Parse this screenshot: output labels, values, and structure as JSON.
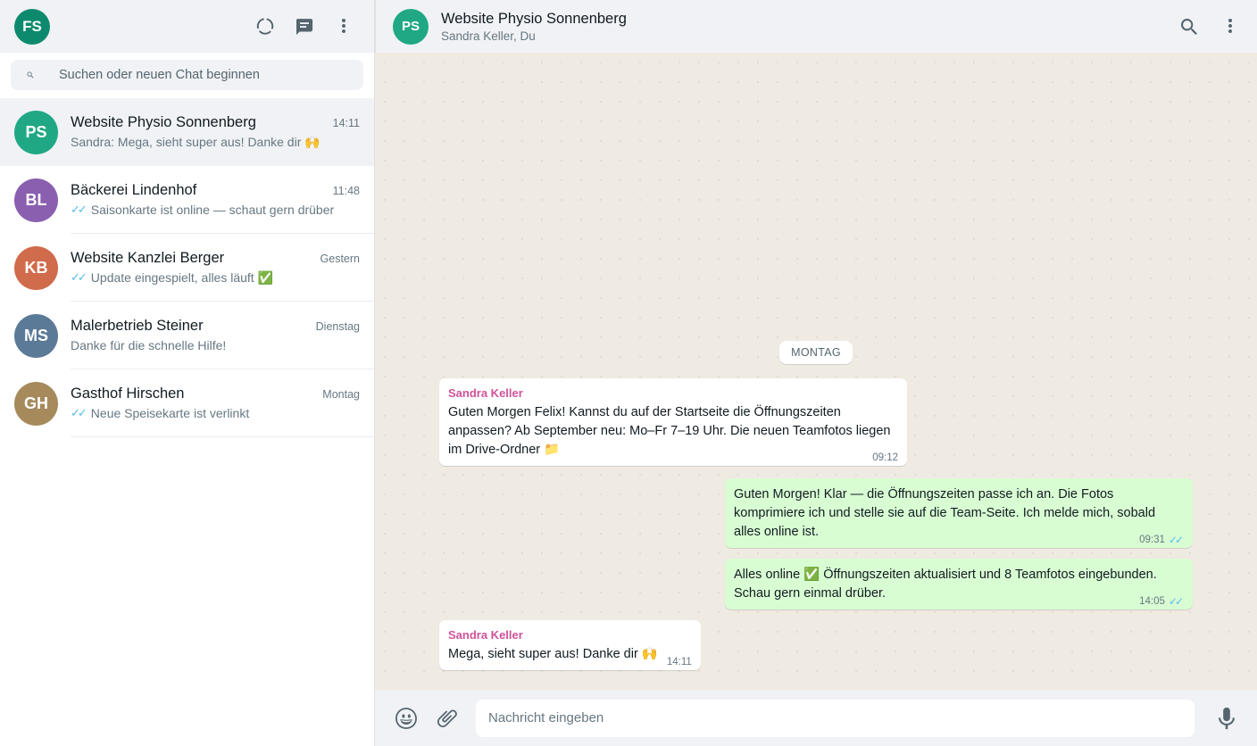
{
  "colors": {
    "me_avatar": "#0d8a6e",
    "accent": "#25d366",
    "sender_name": "#d0529a",
    "read_ticks": "#53bdeb"
  },
  "me": {
    "initials": "FS"
  },
  "left_header": {
    "icons": [
      "status-icon",
      "new-chat-icon",
      "menu-icon"
    ]
  },
  "search": {
    "placeholder": "Suchen oder neuen Chat beginnen",
    "value": ""
  },
  "chats": [
    {
      "initials": "PS",
      "avatar_color": "#20a884",
      "name": "Website Physio Sonnenberg",
      "time": "14:11",
      "ticks": "",
      "preview": "Sandra: Mega, sieht super aus! Danke dir 🙌",
      "active": true
    },
    {
      "initials": "BL",
      "avatar_color": "#8a5fb0",
      "name": "Bäckerei Lindenhof",
      "time": "11:48",
      "ticks": "✓✓",
      "preview": "Saisonkarte ist online — schaut gern drüber",
      "active": false
    },
    {
      "initials": "KB",
      "avatar_color": "#d06b4b",
      "name": "Website Kanzlei Berger",
      "time": "Gestern",
      "ticks": "✓✓",
      "preview": "Update eingespielt, alles läuft ✅",
      "active": false
    },
    {
      "initials": "MS",
      "avatar_color": "#5b7a98",
      "name": "Malerbetrieb Steiner",
      "time": "Dienstag",
      "ticks": "",
      "preview": "Danke für die schnelle Hilfe!",
      "active": false
    },
    {
      "initials": "GH",
      "avatar_color": "#a68a5b",
      "name": "Gasthof Hirschen",
      "time": "Montag",
      "ticks": "✓✓",
      "preview": "Neue Speisekarte ist verlinkt",
      "active": false
    }
  ],
  "conversation": {
    "initials": "PS",
    "avatar_color": "#20a884",
    "title": "Website Physio Sonnenberg",
    "subtitle": "Sandra Keller, Du",
    "day_label": "MONTAG",
    "messages": [
      {
        "direction": "in",
        "sender": "Sandra Keller",
        "text": "Guten Morgen Felix! Kannst du auf der Startseite die Öffnungszeiten anpassen? Ab September neu: Mo–Fr 7–19 Uhr. Die neuen Teamfotos liegen im Drive-Ordner 📁",
        "time": "09:12",
        "ticks": ""
      },
      {
        "direction": "out",
        "sender": "",
        "text": "Guten Morgen! Klar — die Öffnungszeiten passe ich an. Die Fotos komprimiere ich und stelle sie auf die Team-Seite. Ich melde mich, sobald alles online ist.",
        "time": "09:31",
        "ticks": "✓✓"
      },
      {
        "direction": "out",
        "sender": "",
        "text": "Alles online ✅ Öffnungszeiten aktualisiert und 8 Teamfotos eingebunden. Schau gern einmal drüber.",
        "time": "14:05",
        "ticks": "✓✓"
      },
      {
        "direction": "in",
        "sender": "Sandra Keller",
        "text": "Mega, sieht super aus! Danke dir 🙌",
        "time": "14:11",
        "ticks": ""
      }
    ]
  },
  "composer": {
    "placeholder": "Nachricht eingeben",
    "value": ""
  }
}
